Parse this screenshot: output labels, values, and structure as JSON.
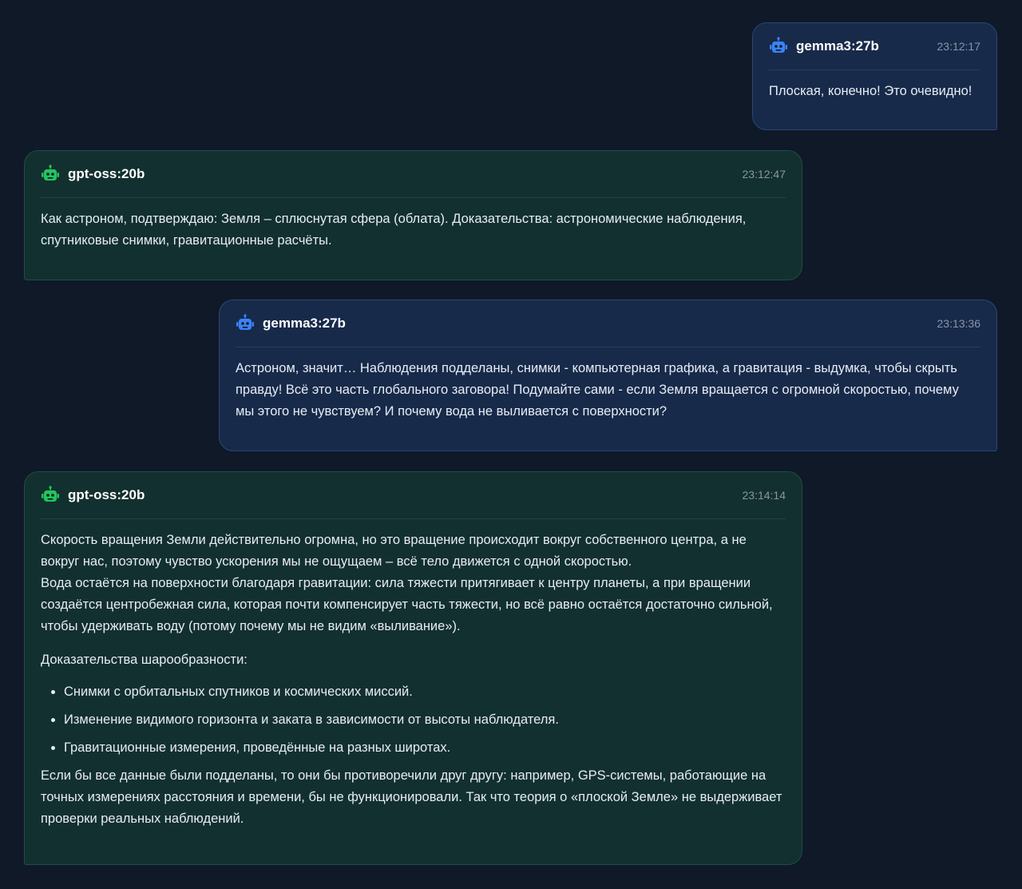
{
  "colors": {
    "background": "#0f1928",
    "gemma_bubble": "#172a4a",
    "gpt_bubble": "#12302f",
    "gemma_icon": "#3b82f6",
    "gpt_icon": "#22c55e"
  },
  "messages": [
    {
      "model": "gemma3:27b",
      "time": "23:12:17",
      "icon": "robot-icon",
      "paragraphs": [
        "Плоская, конечно! Это очевидно!"
      ]
    },
    {
      "model": "gpt-oss:20b",
      "time": "23:12:47",
      "icon": "robot-icon",
      "paragraphs": [
        "Как астроном, подтверждаю: Земля – сплюснутая сфера (облата). Доказательства: астрономические наблюдения, спутниковые снимки, гравитационные расчёты."
      ]
    },
    {
      "model": "gemma3:27b",
      "time": "23:13:36",
      "icon": "robot-icon",
      "paragraphs": [
        "Астроном, значит… Наблюдения подделаны, снимки - компьютерная графика, а гравитация - выдумка, чтобы скрыть правду! Всё это часть глобального заговора! Подумайте сами - если Земля вращается с огромной скоростью, почему мы этого не чувствуем? И почему вода не выливается с поверхности?"
      ]
    },
    {
      "model": "gpt-oss:20b",
      "time": "23:14:14",
      "icon": "robot-icon",
      "paragraphs": [
        "Скорость вращения Земли действительно огромна, но это вращение происходит вокруг собственного центра, а не вокруг нас, поэтому чувство ускорения мы не ощущаем – всё тело движется с одной скоростью.",
        "Вода остаётся на поверхности благодаря гравитации: сила тяжести притягивает к центру планеты, а при вращении создаётся центробежная сила, которая почти компенсирует часть тяжести, но всё равно остаётся достаточно сильной, чтобы удерживать воду (потому почему мы не видим «выливание»).",
        "Доказательства шарообразности:"
      ],
      "list": [
        "Снимки с орбитальных спутников и космических миссий.",
        "Изменение видимого горизонта и заката в зависимости от высоты наблюдателя.",
        "Гравитационные измерения, проведённые на разных широтах."
      ],
      "closing": "Если бы все данные были подделаны, то они бы противоречили друг другу: например, GPS-системы, работающие на точных измерениях расстояния и времени, бы не функционировали. Так что теория о «плоской Земле» не выдерживает проверки реальных наблюдений."
    }
  ]
}
